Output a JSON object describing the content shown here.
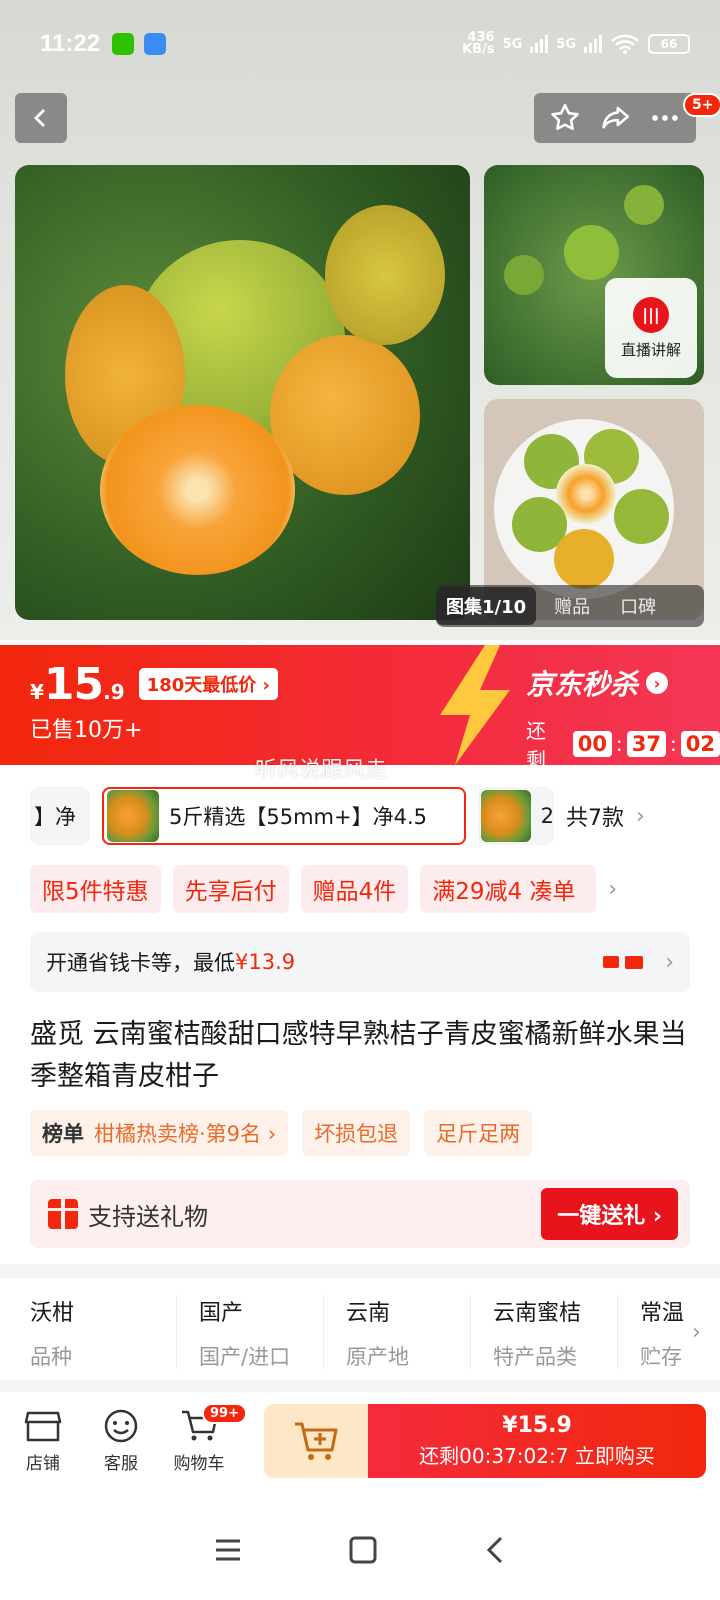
{
  "status": {
    "time": "11:22",
    "net_speed": "436",
    "net_unit": "KB/s",
    "sig1": "5G",
    "sig2": "5G",
    "battery": "66"
  },
  "header": {
    "cart_badge": "5+"
  },
  "gallery": {
    "live_label": "直播讲解",
    "current": "图集1/10",
    "tab_gift": "赠品",
    "tab_review": "口碑"
  },
  "price": {
    "currency": "¥",
    "int": "15",
    "dec": ".9",
    "lowest": "180天最低价 ›",
    "sold": "已售10万+",
    "seckill": "京东秒杀",
    "remain_label": "还剩",
    "hh": "00",
    "mm": "37",
    "ss": "02"
  },
  "watermark": "听风说跟风走",
  "variants": {
    "left_partial": "】净",
    "selected": "5斤精选【55mm+】净4.5",
    "right_partial": "2",
    "count": "共7款"
  },
  "promos": [
    "限5件特惠",
    "先享后付",
    "赠品4件",
    "满29减4  凑单"
  ],
  "card": {
    "text": "开通省钱卡等，最低",
    "price": "¥13.9"
  },
  "title": "盛觅 云南蜜桔酸甜口感特早熟桔子青皮蜜橘新鲜水果当季整箱青皮柑子",
  "rank": {
    "label": "榜单",
    "text": "柑橘热卖榜·第9名 ›",
    "tag1": "坏损包退",
    "tag2": "足斤足两"
  },
  "gift": {
    "text": "支持送礼物",
    "button": "一键送礼 ›"
  },
  "specs": [
    {
      "value": "沃柑",
      "key": "品种"
    },
    {
      "value": "国产",
      "key": "国产/进口"
    },
    {
      "value": "云南",
      "key": "原产地"
    },
    {
      "value": "云南蜜桔",
      "key": "特产品类"
    },
    {
      "value": "常温",
      "key": "贮存"
    }
  ],
  "bottom": {
    "shop": "店铺",
    "service": "客服",
    "cart": "购物车",
    "cart_badge": "99+",
    "buy_price": "¥15.9",
    "buy_label": "还剩00:37:02:7  立即购买"
  }
}
